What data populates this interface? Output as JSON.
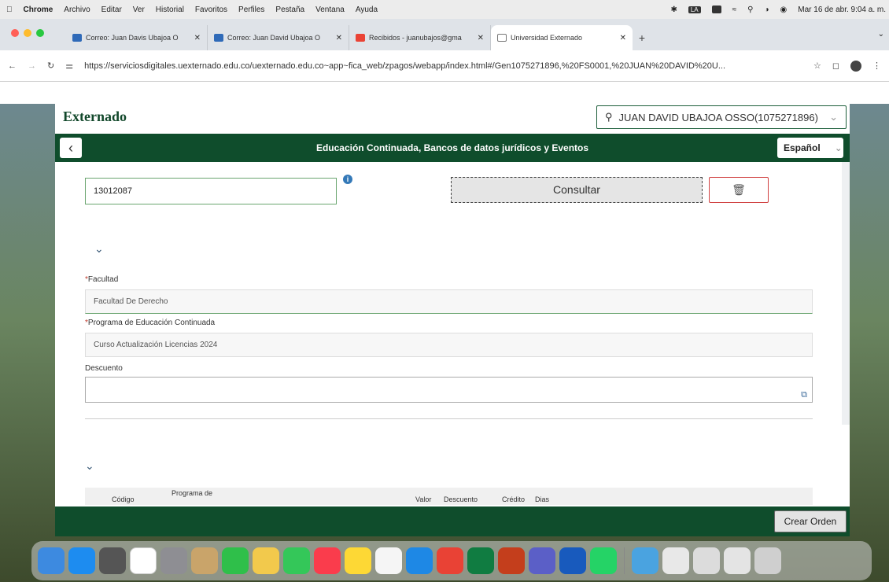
{
  "menubar": {
    "items": [
      "Chrome",
      "Archivo",
      "Editar",
      "Ver",
      "Historial",
      "Favoritos",
      "Perfiles",
      "Pestaña",
      "Ventana",
      "Ayuda"
    ],
    "clock": "Mar 16 de abr. 9:04 a. m.",
    "input_badge": "LA"
  },
  "browser": {
    "tabs": [
      {
        "title": "Correo: Juan Davis Ubajoa O",
        "active": false
      },
      {
        "title": "Correo: Juan David Ubajoa O",
        "active": false
      },
      {
        "title": "Recibidos - juanubajos@gma",
        "active": false
      },
      {
        "title": "Universidad Externado",
        "active": true
      }
    ],
    "url": "https://serviciosdigitales.uexternado.edu.co/uexternado.edu.co~app~fica_web/zpagos/webapp/index.html#/Gen1075271896,%20FS0001,%20JUAN%20DAVID%20U..."
  },
  "header": {
    "logo": "Externado",
    "user": "JUAN DAVID UBAJOA OSSO(1075271896)",
    "title": "Educación Continuada, Bancos de datos jurídicos y Eventos",
    "language": "Español"
  },
  "form": {
    "order_value": "13012087",
    "consultar_label": "Consultar",
    "facultad_label": "Facultad",
    "facultad_value": "Facultad De Derecho",
    "programa_label": "Programa de Educación Continuada",
    "programa_value": "Curso Actualización Licencias 2024",
    "descuento_label": "Descuento",
    "descuento_value": ""
  },
  "table": {
    "headers": [
      "Código",
      "Programa de",
      "Valor",
      "Descuento",
      "Crédito",
      "Dias"
    ]
  },
  "footer": {
    "crear_label": "Crear Orden"
  }
}
